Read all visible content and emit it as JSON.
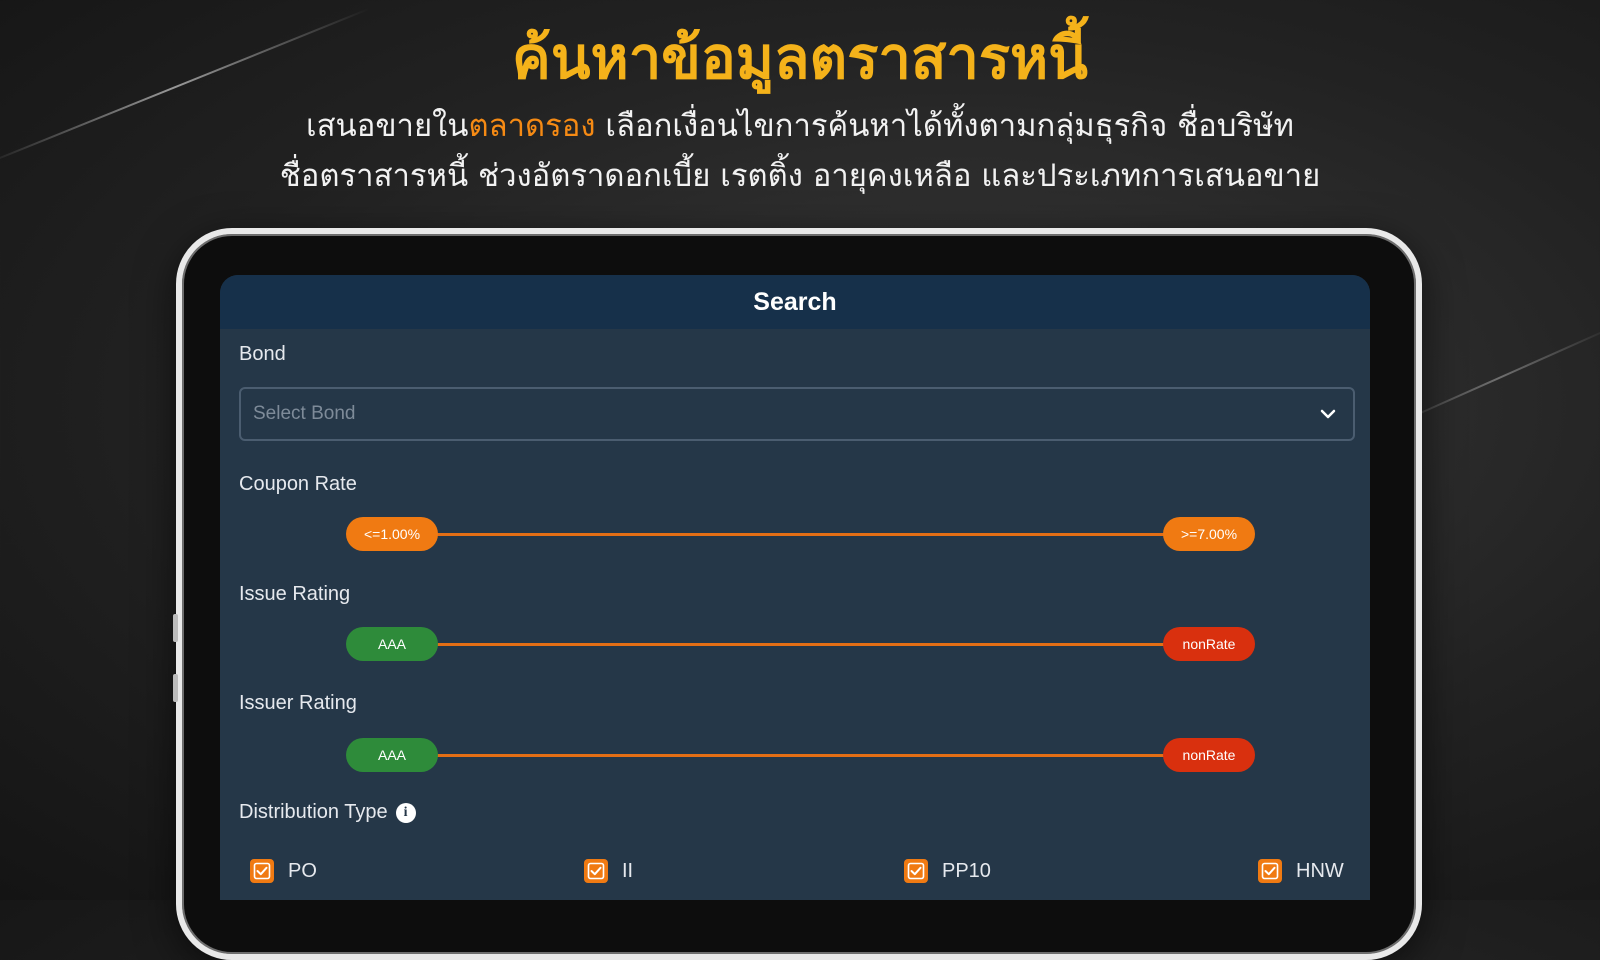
{
  "promo": {
    "headline": "ค้นหาข้อมูลตราสารหนี้",
    "line1_before": "เสนอขายใน",
    "line1_highlight": "ตลาดรอง",
    "line1_after": " เลือกเงื่อนไขการค้นหาได้ทั้งตามกลุ่มธุรกิจ ชื่อบริษัท",
    "line2": "ชื่อตราสารหนี้ ช่วงอัตราดอกเบี้ย  เรตติ้ง  อายุคงเหลือ และประเภทการเสนอขาย"
  },
  "screen": {
    "title": "Search",
    "bond": {
      "label": "Bond",
      "placeholder": "Select Bond"
    },
    "coupon_rate": {
      "label": "Coupon Rate",
      "min": "<=1.00%",
      "max": ">=7.00%"
    },
    "issue_rating": {
      "label": "Issue Rating",
      "min": "AAA",
      "max": "nonRate"
    },
    "issuer_rating": {
      "label": "Issuer Rating",
      "min": "AAA",
      "max": "nonRate"
    },
    "distribution": {
      "label": "Distribution Type",
      "info_glyph": "i",
      "options": [
        {
          "label": "PO",
          "checked": true
        },
        {
          "label": "II",
          "checked": true
        },
        {
          "label": "PP10",
          "checked": true
        },
        {
          "label": "HNW",
          "checked": true
        }
      ]
    }
  },
  "colors": {
    "headline": "#f4b21a",
    "highlight": "#f58a14",
    "accent_orange": "#f07a12",
    "rating_green": "#2e8b3a",
    "rating_red": "#d9300e",
    "panel": "#253748",
    "panel_header": "#16304a"
  },
  "icons": {
    "dropdown": "chevron-down-icon",
    "info": "info-icon",
    "checkbox": "check-icon"
  }
}
